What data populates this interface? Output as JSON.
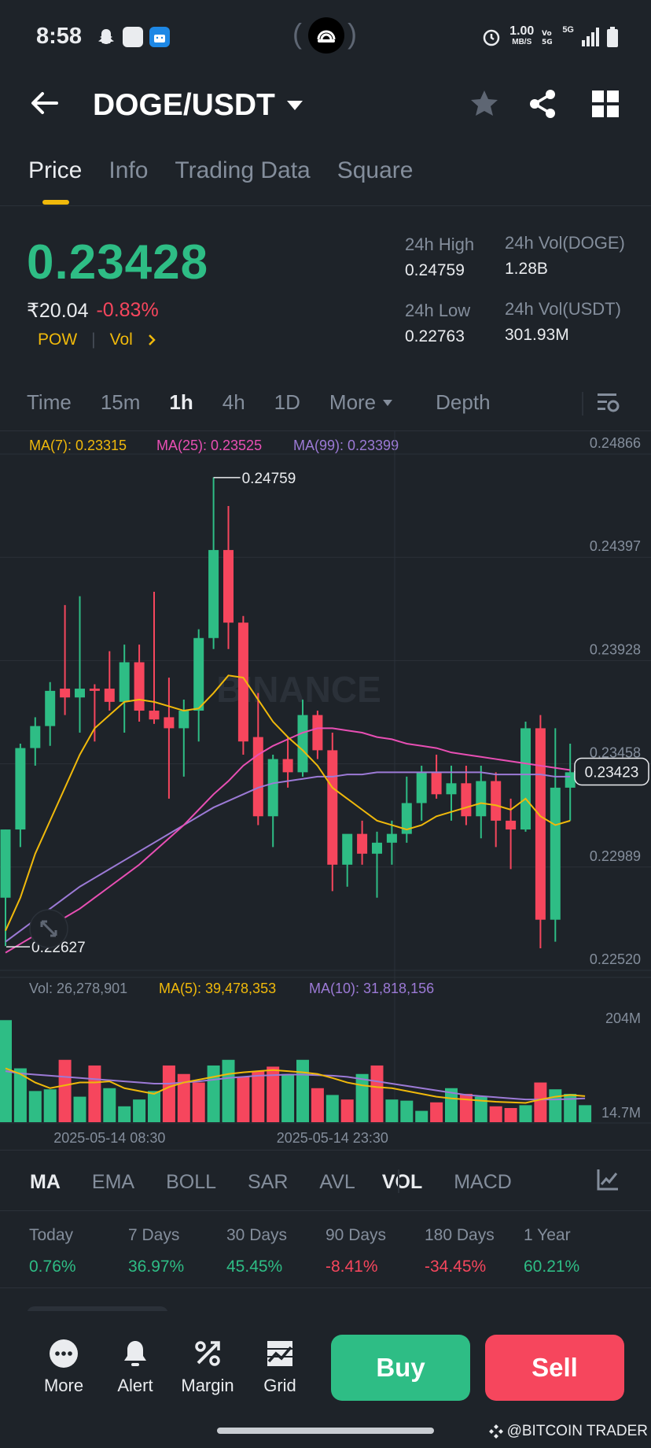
{
  "status_bar": {
    "time": "8:58",
    "speed_value": "1.00",
    "speed_unit": "MB/S",
    "network": "5G"
  },
  "header": {
    "pair": "DOGE/USDT"
  },
  "tabs": [
    {
      "label": "Price",
      "active": true
    },
    {
      "label": "Info",
      "active": false
    },
    {
      "label": "Trading Data",
      "active": false
    },
    {
      "label": "Square",
      "active": false
    }
  ],
  "ticker": {
    "last_price": "0.23428",
    "inr_price": "₹20.04",
    "change": "-0.83%",
    "pow_label": "POW",
    "vol_label": "Vol",
    "high_label": "24h High",
    "high_value": "0.24759",
    "low_label": "24h Low",
    "low_value": "0.22763",
    "vol_doge_label": "24h Vol(DOGE)",
    "vol_doge_value": "1.28B",
    "vol_usdt_label": "24h Vol(USDT)",
    "vol_usdt_value": "301.93M"
  },
  "intervals": [
    {
      "label": "Time",
      "active": false
    },
    {
      "label": "15m",
      "active": false
    },
    {
      "label": "1h",
      "active": true
    },
    {
      "label": "4h",
      "active": false
    },
    {
      "label": "1D",
      "active": false
    },
    {
      "label": "More",
      "active": false
    },
    {
      "label": "Depth",
      "active": false
    }
  ],
  "ma_legend": {
    "ma7": "MA(7): 0.23315",
    "ma25": "MA(25): 0.23525",
    "ma99": "MA(99): 0.23399"
  },
  "vol_legend": {
    "vol": "Vol: 26,278,901",
    "ma5": "MA(5): 39,478,353",
    "ma10": "MA(10): 31,818,156"
  },
  "colors": {
    "up": "#2ebd85",
    "down": "#f6465d",
    "ma7": "#f0b90b",
    "ma25": "#e84fb4",
    "ma99": "#9c7ad6"
  },
  "chart_data": {
    "type": "candlestick",
    "watermark": "BINANCE",
    "y_ticks": [
      "0.24866",
      "0.24397",
      "0.23928",
      "0.23458",
      "0.22989",
      "0.22520"
    ],
    "ylim": [
      0.2252,
      0.24866
    ],
    "current_price_label": "0.23423",
    "current_price": 0.23423,
    "high_marker": "0.24759",
    "high_marker_value": 0.24759,
    "low_marker": "0.22627",
    "low_marker_value": 0.22627,
    "x_labels": [
      "2025-05-14 08:30",
      "2025-05-14 23:30"
    ],
    "x_label_index": [
      7,
      22
    ],
    "candles": [
      {
        "o": 0.2285,
        "h": 0.2316,
        "l": 0.2263,
        "c": 0.2316
      },
      {
        "o": 0.2316,
        "h": 0.2355,
        "l": 0.2308,
        "c": 0.2353
      },
      {
        "o": 0.2353,
        "h": 0.2367,
        "l": 0.2345,
        "c": 0.2363
      },
      {
        "o": 0.2363,
        "h": 0.2383,
        "l": 0.2354,
        "c": 0.2379
      },
      {
        "o": 0.238,
        "h": 0.2418,
        "l": 0.2368,
        "c": 0.2376
      },
      {
        "o": 0.2376,
        "h": 0.2422,
        "l": 0.236,
        "c": 0.238
      },
      {
        "o": 0.238,
        "h": 0.2382,
        "l": 0.2356,
        "c": 0.2379
      },
      {
        "o": 0.238,
        "h": 0.2397,
        "l": 0.237,
        "c": 0.2374
      },
      {
        "o": 0.2374,
        "h": 0.24,
        "l": 0.236,
        "c": 0.2392
      },
      {
        "o": 0.2392,
        "h": 0.24,
        "l": 0.2365,
        "c": 0.237
      },
      {
        "o": 0.237,
        "h": 0.2424,
        "l": 0.2364,
        "c": 0.2366
      },
      {
        "o": 0.2367,
        "h": 0.2385,
        "l": 0.233,
        "c": 0.2362
      },
      {
        "o": 0.2362,
        "h": 0.2375,
        "l": 0.234,
        "c": 0.237
      },
      {
        "o": 0.237,
        "h": 0.2407,
        "l": 0.2356,
        "c": 0.2403
      },
      {
        "o": 0.2403,
        "h": 0.2476,
        "l": 0.2398,
        "c": 0.2443
      },
      {
        "o": 0.2443,
        "h": 0.2463,
        "l": 0.2398,
        "c": 0.241
      },
      {
        "o": 0.241,
        "h": 0.2413,
        "l": 0.235,
        "c": 0.2356
      },
      {
        "o": 0.2358,
        "h": 0.2378,
        "l": 0.2318,
        "c": 0.2322
      },
      {
        "o": 0.2322,
        "h": 0.235,
        "l": 0.2308,
        "c": 0.2348
      },
      {
        "o": 0.2348,
        "h": 0.2358,
        "l": 0.2335,
        "c": 0.2342
      },
      {
        "o": 0.2342,
        "h": 0.2375,
        "l": 0.234,
        "c": 0.2368
      },
      {
        "o": 0.2368,
        "h": 0.237,
        "l": 0.2348,
        "c": 0.2352
      },
      {
        "o": 0.2352,
        "h": 0.236,
        "l": 0.2288,
        "c": 0.23
      },
      {
        "o": 0.23,
        "h": 0.231,
        "l": 0.229,
        "c": 0.2314
      },
      {
        "o": 0.2314,
        "h": 0.232,
        "l": 0.23,
        "c": 0.2305
      },
      {
        "o": 0.2305,
        "h": 0.2315,
        "l": 0.2285,
        "c": 0.231
      },
      {
        "o": 0.231,
        "h": 0.232,
        "l": 0.23,
        "c": 0.2314
      },
      {
        "o": 0.2314,
        "h": 0.234,
        "l": 0.231,
        "c": 0.2328
      },
      {
        "o": 0.2328,
        "h": 0.2345,
        "l": 0.232,
        "c": 0.2342
      },
      {
        "o": 0.2342,
        "h": 0.235,
        "l": 0.233,
        "c": 0.2332
      },
      {
        "o": 0.2332,
        "h": 0.2345,
        "l": 0.232,
        "c": 0.2337
      },
      {
        "o": 0.2337,
        "h": 0.2345,
        "l": 0.2318,
        "c": 0.2322
      },
      {
        "o": 0.2322,
        "h": 0.2345,
        "l": 0.2312,
        "c": 0.2338
      },
      {
        "o": 0.2338,
        "h": 0.2342,
        "l": 0.2308,
        "c": 0.232
      },
      {
        "o": 0.232,
        "h": 0.233,
        "l": 0.2298,
        "c": 0.2316
      },
      {
        "o": 0.2316,
        "h": 0.2365,
        "l": 0.2315,
        "c": 0.2362
      },
      {
        "o": 0.2362,
        "h": 0.2368,
        "l": 0.2262,
        "c": 0.2275
      },
      {
        "o": 0.2275,
        "h": 0.2362,
        "l": 0.2265,
        "c": 0.2335
      },
      {
        "o": 0.2335,
        "h": 0.2355,
        "l": 0.232,
        "c": 0.2342
      }
    ],
    "ma7": [
      0.227,
      0.2285,
      0.2305,
      0.232,
      0.2335,
      0.235,
      0.2362,
      0.2368,
      0.2374,
      0.2375,
      0.2374,
      0.2372,
      0.237,
      0.2371,
      0.2378,
      0.2386,
      0.2385,
      0.2375,
      0.2365,
      0.2358,
      0.2352,
      0.2345,
      0.2335,
      0.233,
      0.2325,
      0.232,
      0.2318,
      0.2316,
      0.2318,
      0.2322,
      0.2324,
      0.2326,
      0.2328,
      0.2327,
      0.2325,
      0.233,
      0.2322,
      0.2318,
      0.232
    ],
    "ma25": [
      0.226,
      0.2264,
      0.2268,
      0.2272,
      0.2276,
      0.228,
      0.2285,
      0.229,
      0.2295,
      0.23,
      0.2306,
      0.2312,
      0.2318,
      0.2325,
      0.2332,
      0.2338,
      0.2345,
      0.235,
      0.2354,
      0.2357,
      0.236,
      0.2362,
      0.2362,
      0.2361,
      0.236,
      0.2358,
      0.2357,
      0.2355,
      0.2354,
      0.2353,
      0.2351,
      0.235,
      0.2349,
      0.2348,
      0.2347,
      0.2346,
      0.2345,
      0.2344,
      0.2343
    ],
    "ma99": [
      0.2265,
      0.227,
      0.2275,
      0.228,
      0.2285,
      0.229,
      0.2294,
      0.2298,
      0.2302,
      0.2306,
      0.231,
      0.2314,
      0.2318,
      0.2322,
      0.2326,
      0.2329,
      0.2332,
      0.2335,
      0.2337,
      0.2338,
      0.2339,
      0.234,
      0.234,
      0.2341,
      0.2341,
      0.2342,
      0.2342,
      0.2342,
      0.2342,
      0.2342,
      0.2342,
      0.2342,
      0.2342,
      0.2341,
      0.2341,
      0.2341,
      0.2341,
      0.234,
      0.234
    ],
    "volume_ticks": [
      "204M",
      "14.7M"
    ],
    "volume_ylim": [
      0,
      204
    ],
    "volumes": [
      180,
      95,
      55,
      58,
      110,
      45,
      100,
      60,
      28,
      40,
      55,
      100,
      85,
      70,
      100,
      110,
      80,
      90,
      98,
      85,
      110,
      60,
      48,
      40,
      85,
      100,
      40,
      38,
      20,
      35,
      60,
      50,
      45,
      28,
      25,
      30,
      70,
      58,
      50,
      30
    ],
    "volume_up": [
      true,
      true,
      true,
      true,
      false,
      true,
      false,
      true,
      true,
      true,
      true,
      false,
      false,
      false,
      true,
      true,
      false,
      false,
      false,
      true,
      true,
      false,
      true,
      false,
      true,
      false,
      true,
      true,
      true,
      false,
      true,
      false,
      true,
      false,
      false,
      true,
      false,
      true,
      true,
      true
    ],
    "vol_ma5": [
      95,
      85,
      70,
      60,
      65,
      70,
      70,
      72,
      60,
      55,
      50,
      62,
      70,
      75,
      80,
      85,
      88,
      90,
      92,
      90,
      88,
      85,
      78,
      70,
      65,
      62,
      60,
      55,
      50,
      45,
      42,
      40,
      38,
      36,
      35,
      34,
      40,
      45,
      48,
      46
    ],
    "vol_ma10": [
      90,
      86,
      84,
      82,
      80,
      78,
      76,
      74,
      72,
      70,
      68,
      68,
      70,
      72,
      75,
      78,
      80,
      82,
      83,
      84,
      84,
      83,
      82,
      80,
      76,
      72,
      68,
      64,
      60,
      56,
      52,
      48,
      46,
      44,
      42,
      40,
      40,
      40,
      41,
      42
    ]
  },
  "indicators": [
    {
      "label": "MA",
      "active": true
    },
    {
      "label": "EMA",
      "active": false
    },
    {
      "label": "BOLL",
      "active": false
    },
    {
      "label": "SAR",
      "active": false
    },
    {
      "label": "AVL",
      "active": false
    },
    {
      "label": "VOL",
      "active": true
    },
    {
      "label": "MACD",
      "active": false
    }
  ],
  "performance": [
    {
      "label": "Today",
      "value": "0.76%",
      "positive": true
    },
    {
      "label": "7 Days",
      "value": "36.97%",
      "positive": true
    },
    {
      "label": "30 Days",
      "value": "45.45%",
      "positive": true
    },
    {
      "label": "90 Days",
      "value": "-8.41%",
      "positive": false
    },
    {
      "label": "180 Days",
      "value": "-34.45%",
      "positive": false
    },
    {
      "label": "1 Year",
      "value": "60.21%",
      "positive": true
    }
  ],
  "bottom_bar": {
    "more": "More",
    "alert": "Alert",
    "margin": "Margin",
    "grid": "Grid",
    "buy": "Buy",
    "sell": "Sell"
  },
  "credit": "@BITCOIN TRADER"
}
